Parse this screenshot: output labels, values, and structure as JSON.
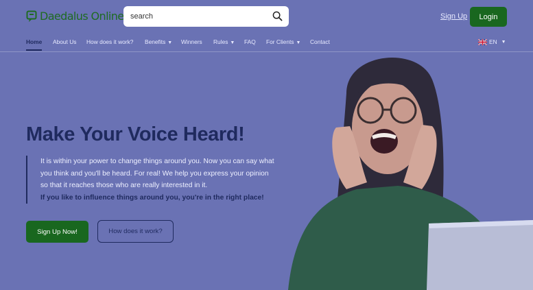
{
  "header": {
    "logo_text": "Daedalus Online",
    "search_placeholder": "search",
    "signup_label": "Sign Up",
    "login_label": "Login"
  },
  "nav": {
    "items": [
      {
        "label": "Home",
        "active": true
      },
      {
        "label": "About Us"
      },
      {
        "label": "How does it work?"
      },
      {
        "label": "Benefits",
        "dropdown": true
      },
      {
        "label": "Winners"
      },
      {
        "label": "Rules",
        "dropdown": true
      },
      {
        "label": "FAQ"
      },
      {
        "label": "For Clients",
        "dropdown": true
      },
      {
        "label": "Contact"
      }
    ],
    "language": "EN"
  },
  "hero": {
    "title": "Make Your Voice Heard!",
    "lines": [
      "It is within your power to change things around you. Now you can say what",
      "you think and you'll be heard. For real! We help you express your opinion",
      "so that it reaches those who are really interested in it."
    ],
    "highlight": "If you like to influence things around you, you're in the right place!",
    "primary_button": "Sign Up Now!",
    "secondary_button": "How does it work?"
  },
  "colors": {
    "brand_green": "#19671f",
    "navy": "#1f2a5e",
    "overlay": "#6a72b4"
  }
}
